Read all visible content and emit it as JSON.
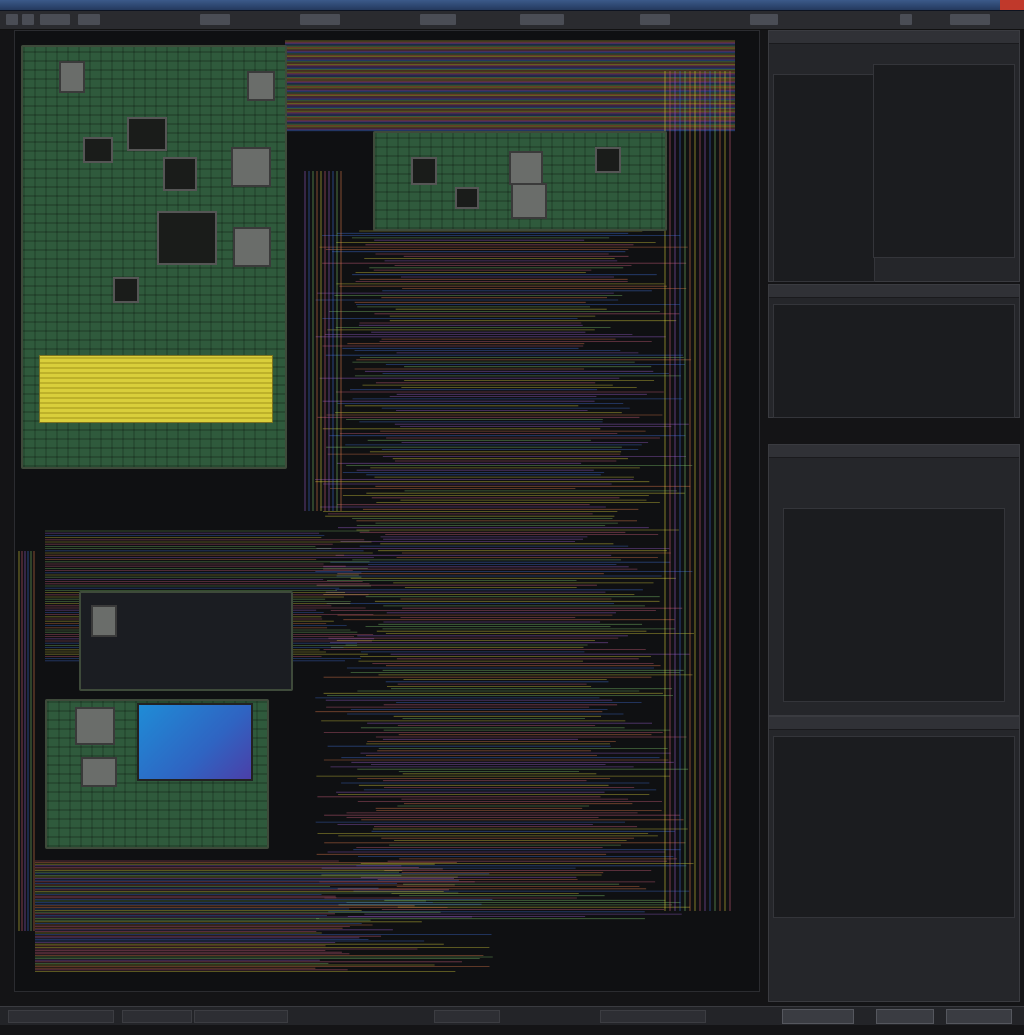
{
  "window": {
    "title_icon": "app-icon",
    "close_icon": "close-icon"
  },
  "canvas": {
    "status_text": ""
  },
  "side_panels": [
    {
      "id": "properties",
      "header": "",
      "lines": []
    },
    {
      "id": "netlist",
      "header": "",
      "lines": []
    },
    {
      "id": "layers",
      "header": "",
      "lines": []
    },
    {
      "id": "console",
      "header": "",
      "lines": []
    }
  ],
  "statusbar": {
    "fields": []
  },
  "colors": {
    "board_green": "#2f5a3c",
    "trace_yellow": "#d9cf3b",
    "trace_pink": "#d2607f",
    "trace_purple": "#9b5fd0",
    "trace_blue": "#3f6fd8",
    "screen_blue": "#1f8cd6"
  }
}
